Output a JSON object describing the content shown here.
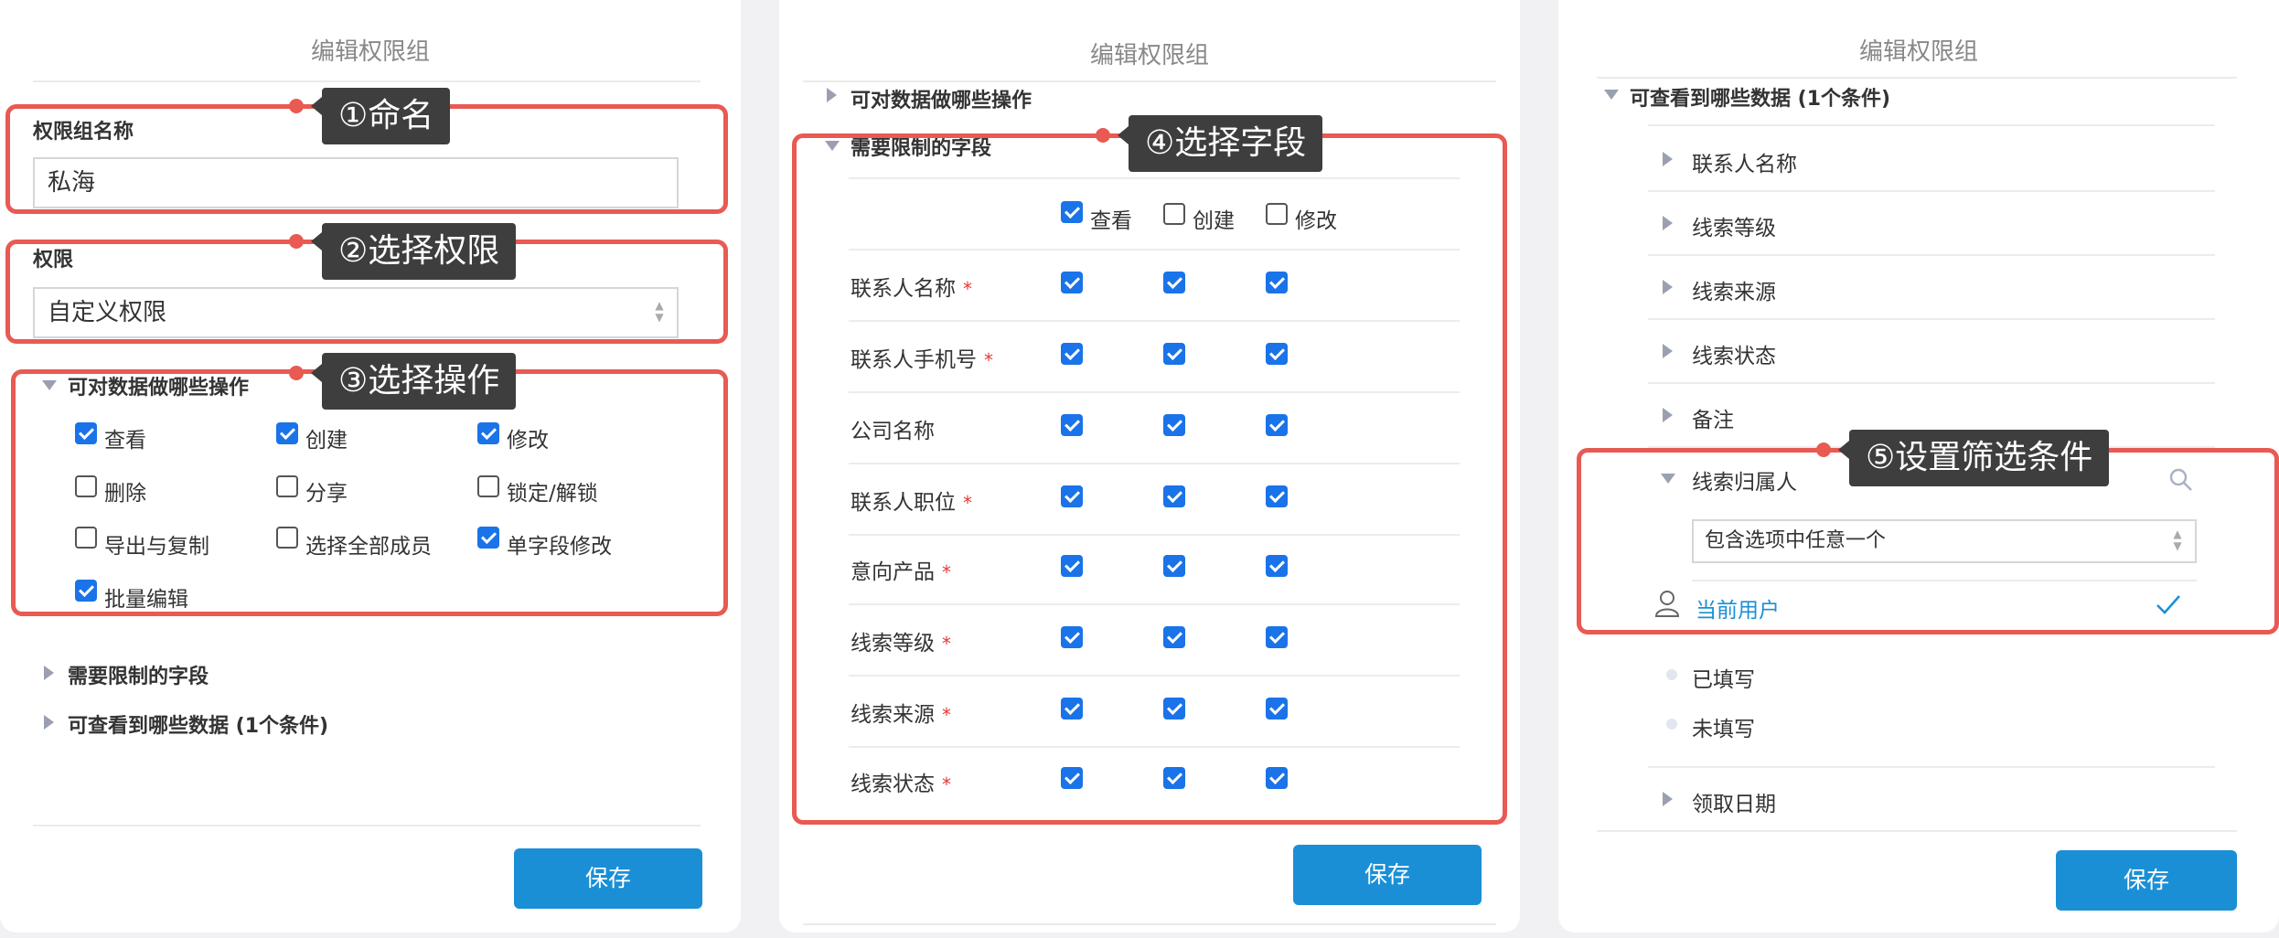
{
  "panel1": {
    "title": "编辑权限组",
    "name_label": "权限组名称",
    "name_value": "私海",
    "perm_label": "权限",
    "perm_value": "自定义权限",
    "ops_header": "可对数据做哪些操作",
    "ops": [
      {
        "label": "查看",
        "checked": true
      },
      {
        "label": "创建",
        "checked": true
      },
      {
        "label": "修改",
        "checked": true
      },
      {
        "label": "删除",
        "checked": false
      },
      {
        "label": "分享",
        "checked": false
      },
      {
        "label": "锁定/解锁",
        "checked": false
      },
      {
        "label": "导出与复制",
        "checked": false
      },
      {
        "label": "选择全部成员",
        "checked": false
      },
      {
        "label": "单字段修改",
        "checked": true
      },
      {
        "label": "批量编辑",
        "checked": true
      }
    ],
    "fields_header": "需要限制的字段",
    "data_header": "可查看到哪些数据 (1个条件)",
    "save": "保存",
    "tag1": "①命名",
    "tag2": "②选择权限",
    "tag3": "③选择操作"
  },
  "panel2": {
    "title": "编辑权限组",
    "ops_header": "可对数据做哪些操作",
    "fields_header": "需要限制的字段",
    "columns": [
      "查看",
      "创建",
      "修改"
    ],
    "columns_checked": [
      true,
      false,
      false
    ],
    "required_mark": "*",
    "rows": [
      {
        "label": "联系人名称",
        "required": true
      },
      {
        "label": "联系人手机号",
        "required": true
      },
      {
        "label": "公司名称",
        "required": false
      },
      {
        "label": "联系人职位",
        "required": true
      },
      {
        "label": "意向产品",
        "required": true
      },
      {
        "label": "线索等级",
        "required": true
      },
      {
        "label": "线索来源",
        "required": true
      },
      {
        "label": "线索状态",
        "required": true
      }
    ],
    "save": "保存",
    "tag4": "④选择字段"
  },
  "panel3": {
    "title": "编辑权限组",
    "data_header": "可查看到哪些数据 (1个条件)",
    "items": [
      "联系人名称",
      "线索等级",
      "线索来源",
      "线索状态",
      "备注"
    ],
    "owner_label": "线索归属人",
    "owner_select": "包含选项中任意一个",
    "current_user": "当前用户",
    "filled": "已填写",
    "unfilled": "未填写",
    "date_item": "领取日期",
    "save": "保存",
    "tag5": "⑤设置筛选条件"
  },
  "colors": {
    "accent": "#1a8fd6",
    "checkbox": "#1a73e8",
    "highlight": "#e85a52",
    "tag_bg": "#3e3e3e"
  }
}
